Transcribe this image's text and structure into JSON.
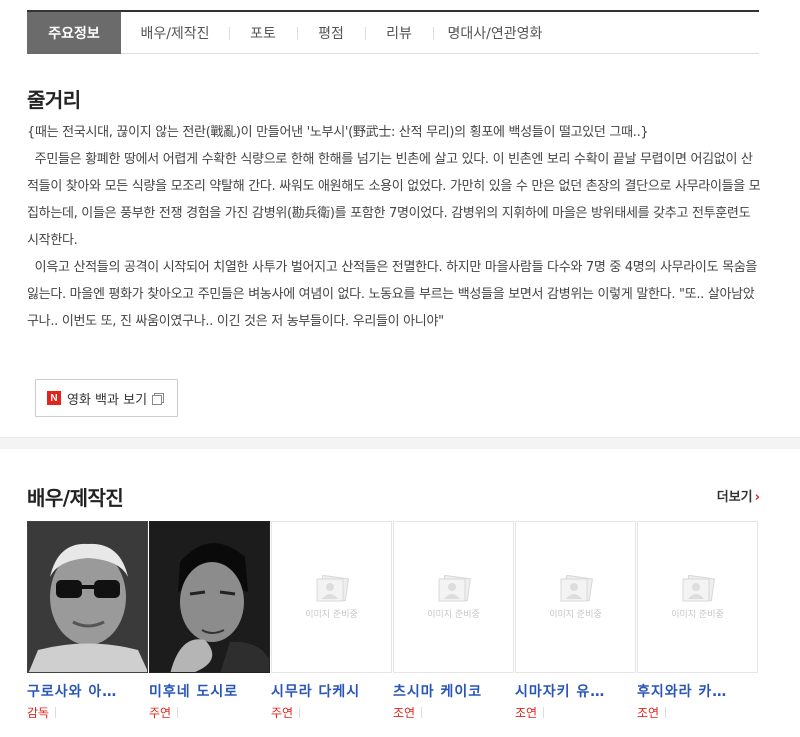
{
  "tabs": [
    {
      "label": "주요정보",
      "active": true
    },
    {
      "label": "배우/제작진",
      "active": false
    },
    {
      "label": "포토",
      "active": false
    },
    {
      "label": "평점",
      "active": false
    },
    {
      "label": "리뷰",
      "active": false
    },
    {
      "label": "명대사/연관영화",
      "active": false
    }
  ],
  "synopsis": {
    "title": "줄거리",
    "paragraphs": [
      "{때는 전국시대, 끊이지 않는 전란(戰亂)이 만들어낸 '노부시'(野武士: 산적 무리)의 횡포에 백성들이 떨고있던 그때..}",
      "  주민들은 황폐한 땅에서 어렵게 수확한 식량으로 한해 한해를 넘기는 빈촌에 살고 있다. 이 빈촌엔 보리 수확이 끝날 무렵이면 어김없이 산적들이 찾아와 모든 식량을 모조리 약탈해 간다. 싸워도 애원해도 소용이 없었다. 가만히 있을 수 만은 없던 촌장의 결단으로 사무라이들을 모집하는데, 이들은 풍부한 전쟁 경험을 가진 감병위(勘兵衛)를 포함한 7명이었다. 감병위의 지휘하에 마을은 방위태세를 갖추고 전투훈련도 시작한다.",
      "  이윽고 산적들의 공격이 시작되어 치열한 사투가 벌어지고 산적들은 전멸한다. 하지만 마을사람들 다수와 7명 중 4명의 사무라이도 목숨을 잃는다. 마을엔 평화가 찾아오고 주민들은 벼농사에 여념이 없다. 노동요를 부르는 백성들을 보면서 감병위는 이렇게 말한다. \"또.. 살아남았구나.. 이번도 또, 진 싸움이였구나.. 이긴 것은 저 농부들이다. 우리들이 아니야\""
    ],
    "encyclopedia_button": {
      "logo": "N",
      "label": "영화 백과 보기"
    }
  },
  "cast_section": {
    "title": "배우/제작진",
    "more_label": "더보기",
    "placeholder_text": "이미지 준비중",
    "members": [
      {
        "name": "구로사와 아…",
        "role": "감독",
        "photo": "portrait-glasses"
      },
      {
        "name": "미후네 도시로",
        "role": "주연",
        "photo": "portrait-samurai"
      },
      {
        "name": "시무라 다케시",
        "role": "주연",
        "photo": "placeholder"
      },
      {
        "name": "츠시마 케이코",
        "role": "조연",
        "photo": "placeholder"
      },
      {
        "name": "시마자키 유…",
        "role": "조연",
        "photo": "placeholder"
      },
      {
        "name": "후지와라 카…",
        "role": "조연",
        "photo": "placeholder"
      }
    ]
  }
}
